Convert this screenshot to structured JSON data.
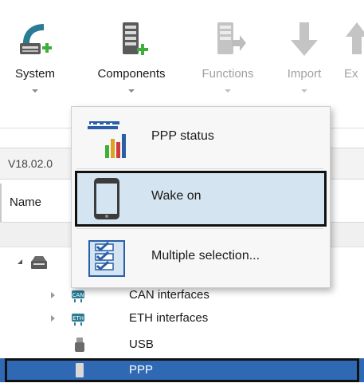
{
  "toolbar": {
    "buttons": [
      {
        "label": "System",
        "enabled": true,
        "icon": "system-add-icon"
      },
      {
        "label": "Components",
        "enabled": true,
        "icon": "components-add-icon"
      },
      {
        "label": "Functions",
        "enabled": false,
        "icon": "functions-icon"
      },
      {
        "label": "Import",
        "enabled": false,
        "icon": "import-icon"
      },
      {
        "label": "Ex",
        "enabled": true,
        "icon": "export-icon"
      }
    ]
  },
  "panel": {
    "version": "V18.02.0",
    "column_name": "Name"
  },
  "tree": {
    "rows": [
      {
        "label": "",
        "icon": "device-icon",
        "expanded": true
      },
      {
        "label": "CAN interfaces",
        "icon": "can-icon",
        "expanded": false
      },
      {
        "label": "ETH interfaces",
        "icon": "eth-icon",
        "expanded": false
      },
      {
        "label": "USB",
        "icon": "usb-icon"
      },
      {
        "label": "PPP",
        "icon": "ppp-icon",
        "selected": true
      }
    ]
  },
  "menu": {
    "items": [
      {
        "label": "PPP status",
        "icon": "ppp-status-chart-icon"
      },
      {
        "label": "Wake on",
        "icon": "tablet-icon",
        "highlighted": true
      },
      {
        "label": "Multiple selection...",
        "icon": "checklist-icon"
      }
    ]
  },
  "colors": {
    "selection": "#2f69b4",
    "menu_highlight": "#d4e4f0",
    "accent_green": "#3fae3a",
    "accent_teal": "#2a7b94"
  }
}
